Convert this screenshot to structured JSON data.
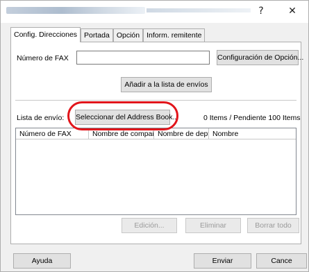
{
  "titlebar": {
    "help_glyph": "?",
    "close_glyph": "✕"
  },
  "tabs": [
    {
      "label": "Config. Direcciones"
    },
    {
      "label": "Portada"
    },
    {
      "label": "Opción"
    },
    {
      "label": "Inform. remitente"
    }
  ],
  "form": {
    "fax_label": "Número de FAX",
    "fax_value": "",
    "option_button": "Configuración de Opción...",
    "add_button": "Añadir a la lista de envíos"
  },
  "list": {
    "label": "Lista de envío:",
    "address_book_button": "Seleccionar del Address Book...",
    "count_text": "0 Items / Pendiente 100 Items",
    "columns": [
      "Número de FAX",
      "Nombre de compañía",
      "Nombre de dept",
      "Nombre"
    ]
  },
  "actions": {
    "edit": "Edición...",
    "delete": "Eliminar",
    "delete_all": "Borrar todo"
  },
  "footer": {
    "help": "Ayuda",
    "send": "Enviar",
    "cancel": "Cance"
  },
  "colors": {
    "highlight_ring": "#e2151b"
  }
}
